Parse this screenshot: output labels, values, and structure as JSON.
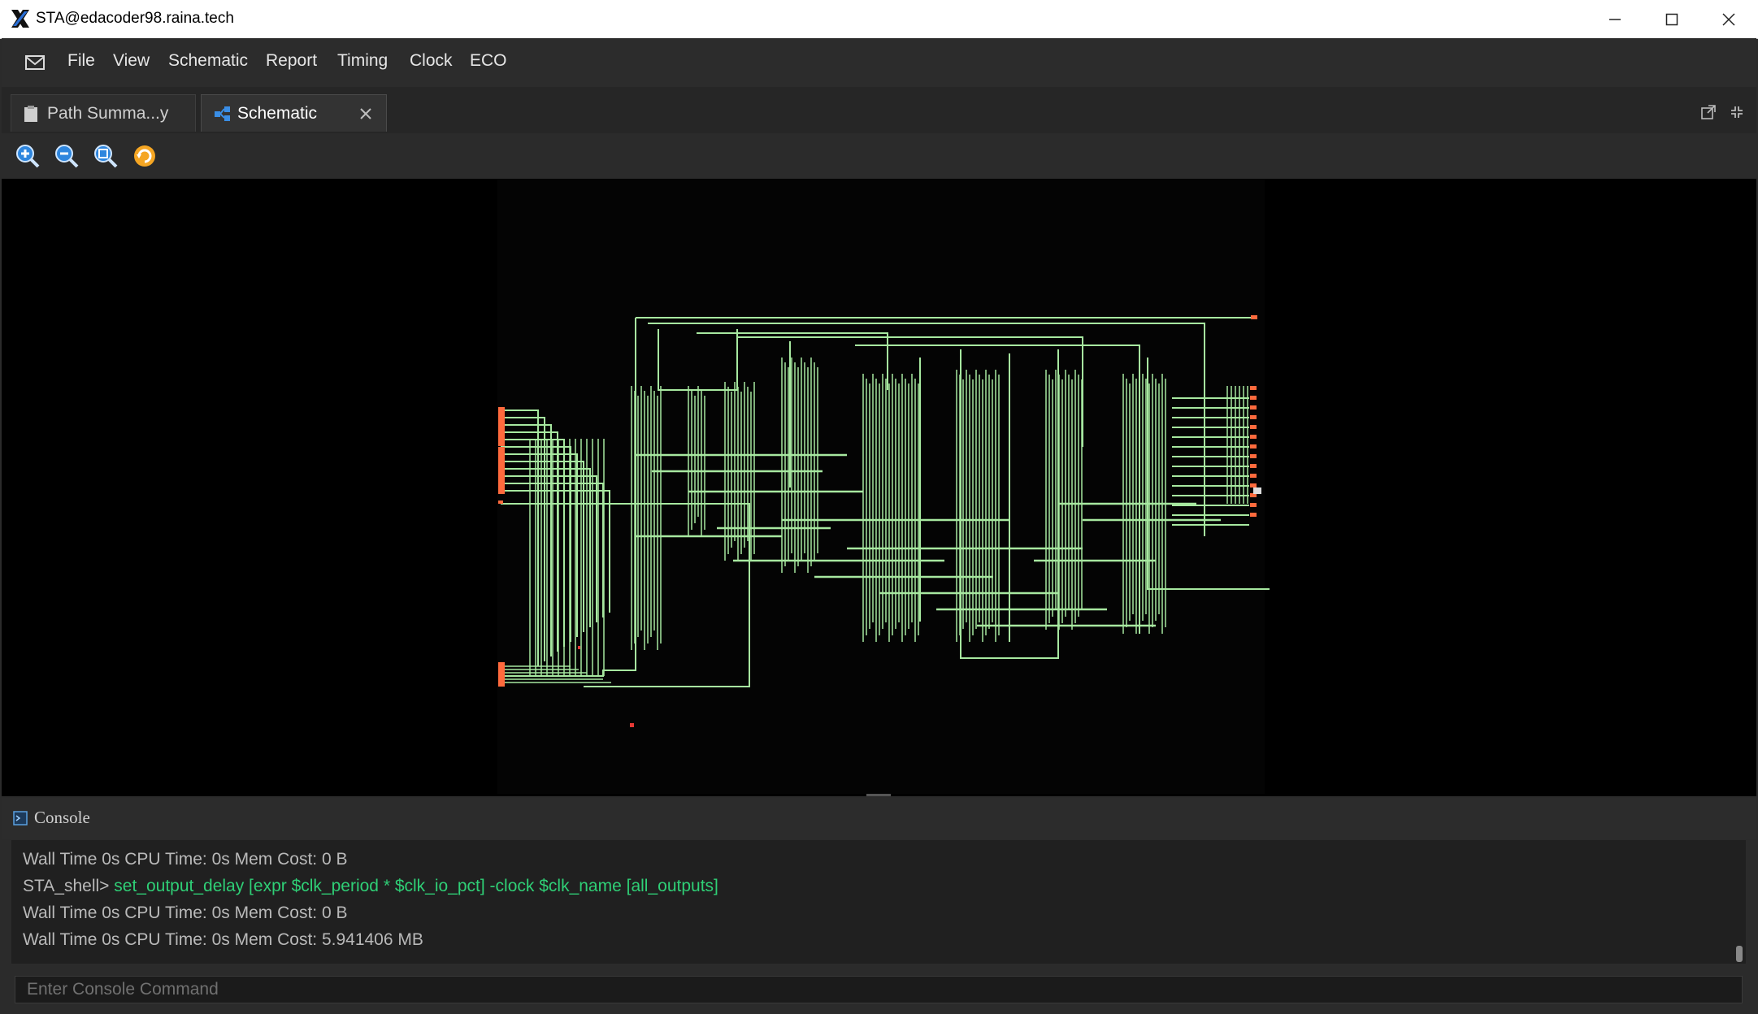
{
  "window": {
    "title": "STA@edacoder98.raina.tech"
  },
  "menu": {
    "items": [
      "File",
      "View",
      "Schematic",
      "Report",
      "Timing",
      "Clock",
      "ECO"
    ]
  },
  "tabs": [
    {
      "label": "Path Summa...y"
    },
    {
      "label": "Schematic"
    }
  ],
  "console": {
    "title": "Console",
    "lines": [
      {
        "prefix": "",
        "command": "",
        "text": "Wall Time 0s CPU Time: 0s Mem Cost: 0 B"
      },
      {
        "prefix": "STA_shell>",
        "command": "set_output_delay [expr $clk_period * $clk_io_pct] -clock $clk_name [all_outputs]",
        "text": ""
      },
      {
        "prefix": "",
        "command": "",
        "text": "Wall Time 0s CPU Time: 0s Mem Cost: 0 B"
      },
      {
        "prefix": "",
        "command": "",
        "text": "Wall Time 0s CPU Time: 0s Mem Cost: 5.941406 MB"
      }
    ],
    "input_placeholder": "Enter Console Command"
  },
  "colors": {
    "wire": "#a7e8a0",
    "port": "#ff6a3d",
    "background": "#000000",
    "command_text": "#2fcf76"
  },
  "icons": {
    "toolbar": [
      "zoom-in-icon",
      "zoom-out-icon",
      "zoom-fit-icon",
      "refresh-icon"
    ]
  }
}
